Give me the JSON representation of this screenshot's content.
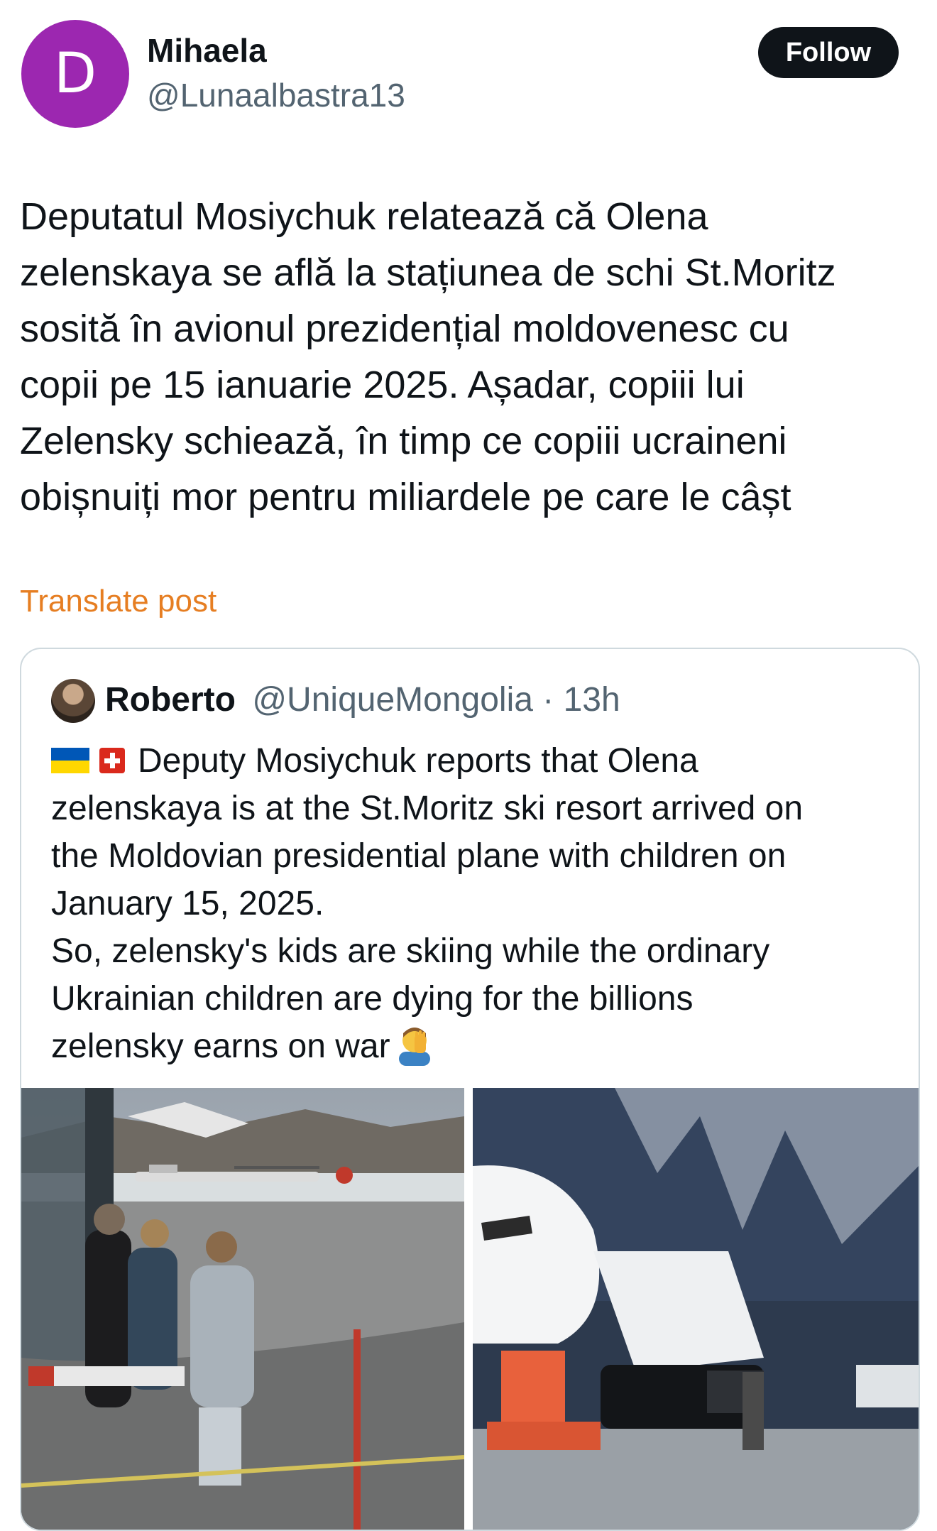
{
  "author": {
    "avatar_letter": "D",
    "avatar_color": "#9c27b0",
    "name": "Mihaela",
    "handle": "@Lunaalbastra13"
  },
  "follow_label": "Follow",
  "post": {
    "text": "Deputatul Mosiychuk relatează că Olena\nzelenskaya se află la stațiunea de schi St.Moritz\nsosită în avionul prezidențial moldovenesc cu\ncopii pe 15 ianuarie 2025. Așadar, copiii lui\nZelensky schiează, în timp ce copiii ucraineni\nobișnuiți mor pentru miliardele pe care le câșt"
  },
  "translate_label": "Translate post",
  "quote": {
    "name": "Roberto",
    "handle": "@UniqueMongolia",
    "separator": " · ",
    "time": "13h",
    "flags": [
      "flag-ukraine-icon",
      "flag-switzerland-icon"
    ],
    "text_first": "Deputy Mosiychuk reports that Olena",
    "text_rest": "zelenskaya is at the St.Moritz ski resort arrived on\nthe Moldovian presidential plane with children on\nJanuary 15, 2025.\nSo, zelensky's kids are skiing while the ordinary\nUkrainian children are dying for the billions\nzelensky earns on war",
    "end_emoji": "facepalm-icon"
  },
  "colors": {
    "accent_translate": "#e67e22",
    "follow_bg": "#0f1419",
    "secondary_text": "#536471"
  }
}
